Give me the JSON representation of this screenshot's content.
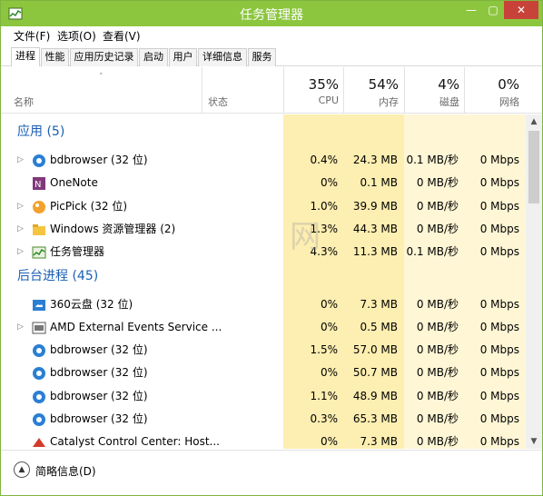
{
  "window": {
    "title": "任务管理器"
  },
  "titlebar": {
    "min": "—",
    "max": "▢",
    "close": "✕"
  },
  "menu": [
    "文件(F)",
    "选项(O)",
    "查看(V)"
  ],
  "tabs": [
    "进程",
    "性能",
    "应用历史记录",
    "启动",
    "用户",
    "详细信息",
    "服务"
  ],
  "active_tab": 0,
  "columns": {
    "name": "名称",
    "status": "状态",
    "cpu": {
      "pct": "35%",
      "label": "CPU"
    },
    "memory": {
      "pct": "54%",
      "label": "内存"
    },
    "disk": {
      "pct": "4%",
      "label": "磁盘"
    },
    "network": {
      "pct": "0%",
      "label": "网络"
    }
  },
  "groups": [
    {
      "title": "应用 (5)",
      "rows": [
        {
          "expand": true,
          "icon": "bdbrowser-icon",
          "name": "bdbrowser (32 位)",
          "cpu": "0.4%",
          "mem": "24.3 MB",
          "disk": "0.1 MB/秒",
          "net": "0 Mbps"
        },
        {
          "expand": false,
          "icon": "onenote-icon",
          "name": "OneNote",
          "cpu": "0%",
          "mem": "0.1 MB",
          "disk": "0 MB/秒",
          "net": "0 Mbps"
        },
        {
          "expand": true,
          "icon": "picpick-icon",
          "name": "PicPick (32 位)",
          "cpu": "1.0%",
          "mem": "39.9 MB",
          "disk": "0 MB/秒",
          "net": "0 Mbps"
        },
        {
          "expand": true,
          "icon": "explorer-icon",
          "name": "Windows 资源管理器 (2)",
          "cpu": "1.3%",
          "mem": "44.3 MB",
          "disk": "0 MB/秒",
          "net": "0 Mbps"
        },
        {
          "expand": true,
          "icon": "task-manager-icon",
          "name": "任务管理器",
          "cpu": "4.3%",
          "mem": "11.3 MB",
          "disk": "0.1 MB/秒",
          "net": "0 Mbps"
        }
      ]
    },
    {
      "title": "后台进程 (45)",
      "rows": [
        {
          "expand": false,
          "icon": "360-cloud-icon",
          "name": "360云盘 (32 位)",
          "cpu": "0%",
          "mem": "7.3 MB",
          "disk": "0 MB/秒",
          "net": "0 Mbps"
        },
        {
          "expand": true,
          "icon": "amd-service-icon",
          "name": "AMD External Events Service ...",
          "cpu": "0%",
          "mem": "0.5 MB",
          "disk": "0 MB/秒",
          "net": "0 Mbps"
        },
        {
          "expand": false,
          "icon": "bdbrowser-icon",
          "name": "bdbrowser (32 位)",
          "cpu": "1.5%",
          "mem": "57.0 MB",
          "disk": "0 MB/秒",
          "net": "0 Mbps"
        },
        {
          "expand": false,
          "icon": "bdbrowser-icon",
          "name": "bdbrowser (32 位)",
          "cpu": "0%",
          "mem": "50.7 MB",
          "disk": "0 MB/秒",
          "net": "0 Mbps"
        },
        {
          "expand": false,
          "icon": "bdbrowser-icon",
          "name": "bdbrowser (32 位)",
          "cpu": "1.1%",
          "mem": "48.9 MB",
          "disk": "0 MB/秒",
          "net": "0 Mbps"
        },
        {
          "expand": false,
          "icon": "bdbrowser-icon",
          "name": "bdbrowser (32 位)",
          "cpu": "0.3%",
          "mem": "65.3 MB",
          "disk": "0 MB/秒",
          "net": "0 Mbps"
        },
        {
          "expand": false,
          "icon": "catalyst-icon",
          "name": "Catalyst Control Center: Host...",
          "cpu": "0%",
          "mem": "7.3 MB",
          "disk": "0 MB/秒",
          "net": "0 Mbps"
        }
      ]
    }
  ],
  "footer": {
    "fewer_details": "简略信息(D)"
  },
  "watermark": "网",
  "colors": {
    "titlebar": "#8cc63f",
    "close": "#c7433a",
    "group_text": "#1a5fb4",
    "heat_light": "#fff6d5",
    "heat_mid": "#fdeeb1"
  }
}
